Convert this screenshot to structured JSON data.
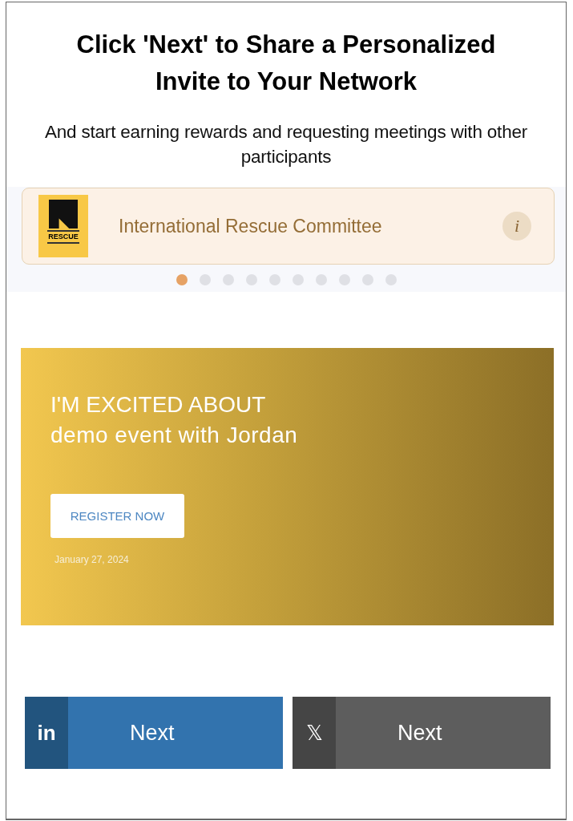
{
  "heading": "Click 'Next' to Share a Personalized Invite to Your Network",
  "subheading": "And start earning rewards and requesting meetings with other participants",
  "carousel": {
    "organization": {
      "name": "International Rescue Committee",
      "logo_text": "RESCUE",
      "info": "i"
    },
    "dots": [
      {
        "selected": true
      },
      {
        "selected": false
      },
      {
        "selected": false
      },
      {
        "selected": false
      },
      {
        "selected": false
      },
      {
        "selected": false
      },
      {
        "selected": false
      },
      {
        "selected": false
      },
      {
        "selected": false
      },
      {
        "selected": false
      }
    ]
  },
  "banner": {
    "kicker": "I'M EXCITED ABOUT",
    "event": "demo event with Jordan",
    "button": "REGISTER NOW",
    "date": "January 27, 2024"
  },
  "share_buttons": [
    {
      "kind": "linkedin",
      "icon": "in",
      "label": "Next"
    },
    {
      "kind": "x",
      "icon": "𝕏",
      "label": "Next"
    }
  ]
}
